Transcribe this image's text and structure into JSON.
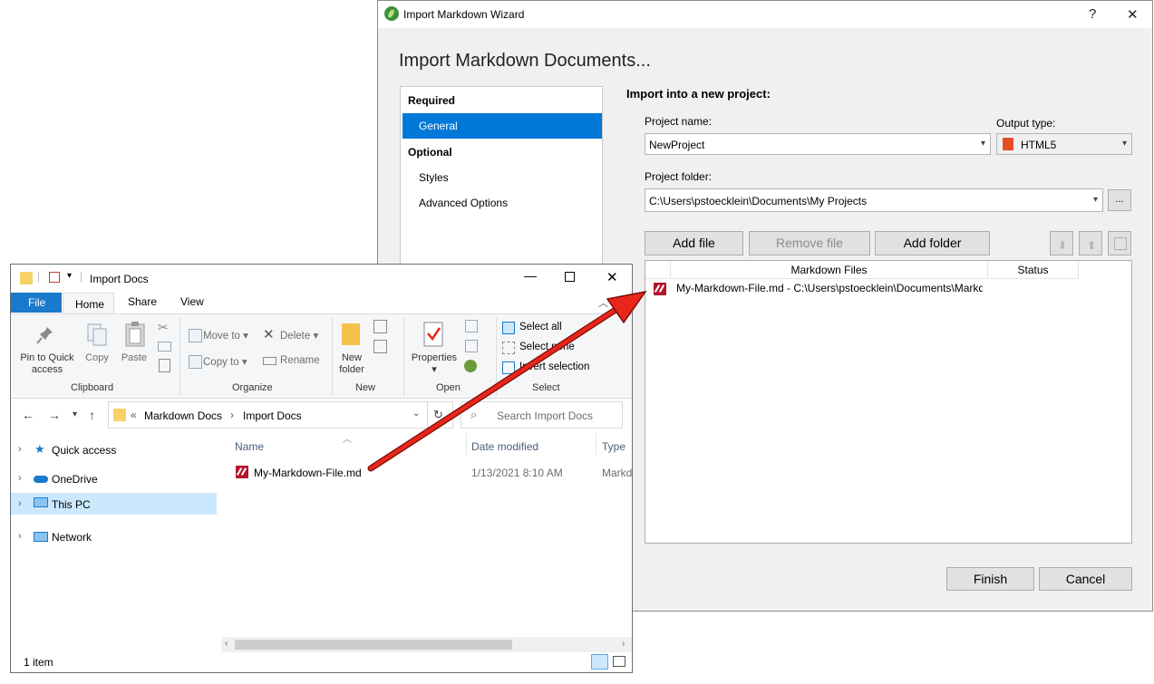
{
  "wizard": {
    "title": "Import Markdown Wizard",
    "help": "?",
    "close": "✕",
    "heading": "Import Markdown Documents...",
    "nav": {
      "required_label": "Required",
      "required_items": [
        "General"
      ],
      "optional_label": "Optional",
      "optional_items": [
        "Styles",
        "Advanced Options"
      ]
    },
    "section_title": "Import into a new project:",
    "project_name_label": "Project name:",
    "project_name_value": "NewProject",
    "output_type_label": "Output type:",
    "output_type_value": "HTML5",
    "project_folder_label": "Project folder:",
    "project_folder_value": "C:\\Users\\pstoecklein\\Documents\\My Projects",
    "browse_label": "...",
    "add_file": "Add file",
    "remove_file": "Remove file",
    "add_folder": "Add folder",
    "columns": [
      "Markdown Files",
      "Status"
    ],
    "files": [
      "My-Markdown-File.md - C:\\Users\\pstoecklein\\Documents\\Markd"
    ],
    "finish": "Finish",
    "cancel": "Cancel"
  },
  "explorer": {
    "title": "Import Docs",
    "tabs": [
      "File",
      "Home",
      "Share",
      "View"
    ],
    "ribbon": {
      "pin": "Pin to Quick access",
      "copy": "Copy",
      "paste": "Paste",
      "move_to": "Move to",
      "copy_to": "Copy to",
      "delete": "Delete",
      "rename": "Rename",
      "new_folder": "New folder",
      "properties": "Properties",
      "select_all": "Select all",
      "select_none": "Select none",
      "invert_selection": "Invert selection",
      "groups": [
        "Clipboard",
        "Organize",
        "New",
        "Open",
        "Select"
      ]
    },
    "breadcrumb": [
      "Markdown Docs",
      "Import Docs"
    ],
    "search_placeholder": "Search Import Docs",
    "nav": [
      "Quick access",
      "OneDrive",
      "This PC",
      "Network"
    ],
    "columns": [
      "Name",
      "Date modified",
      "Type"
    ],
    "files": [
      {
        "name": "My-Markdown-File.md",
        "date": "1/13/2021 8:10 AM",
        "type": "Markdo"
      }
    ],
    "status": "1 item"
  },
  "colors": {
    "accent": "#0078d7",
    "arrow": "#e8261c",
    "md_icon": "#b3162a"
  }
}
